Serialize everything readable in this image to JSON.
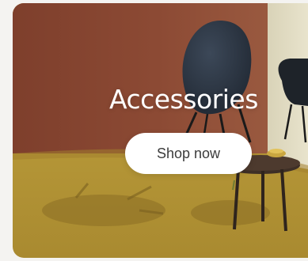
{
  "banner": {
    "title": "Accessories",
    "cta_label": "Shop now"
  },
  "colors": {
    "wall": "#8c4a34",
    "floor": "#b89a3a",
    "chair": "#2f3a48",
    "button_bg": "#ffffff",
    "button_text": "#3b3b3b",
    "title_text": "#ffffff"
  }
}
